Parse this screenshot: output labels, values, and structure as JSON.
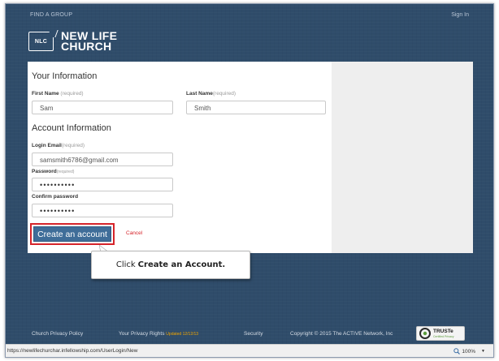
{
  "topnav": {
    "find_group": "FIND A GROUP",
    "sign_in": "Sign In"
  },
  "logo": {
    "badge": "NLC",
    "line1": "NEW LIFE",
    "line2": "CHURCH"
  },
  "form": {
    "your_info_title": "Your Information",
    "first_name_label": "First Name",
    "first_name_req": " (required)",
    "first_name_value": "Sam",
    "last_name_label": "Last Name",
    "last_name_req": "(required)",
    "last_name_value": "Smith",
    "account_info_title": "Account Information",
    "login_email_label": "Login Email",
    "login_email_req": "(required)",
    "login_email_value": "samsmith6786@gmail.com",
    "password_label": "Password",
    "password_req": "(required)",
    "password_value": "••••••••••",
    "confirm_label": "Confirm password",
    "confirm_value": "••••••••••",
    "create_button": "Create an account",
    "cancel": "Cancel"
  },
  "callout": {
    "prefix": "Click",
    "action": "Create an Account."
  },
  "footer": {
    "privacy": "Church Privacy Policy",
    "rights": "Your Privacy Rights",
    "updated": "Updated 12/12/13",
    "security": "Security",
    "copyright": "Copyright © 2015 The ACTIVE Network, Inc",
    "truste": "TRUSTe",
    "truste_sub": "Certified Privacy"
  },
  "statusbar": {
    "url": "https://newlifechurchar.infellowship.com/UserLogin/New",
    "zoom": "100%"
  },
  "colors": {
    "page_bg": "#2f4c6a",
    "button": "#3f6d99",
    "highlight": "#d6242a",
    "updated": "#f0a500"
  }
}
